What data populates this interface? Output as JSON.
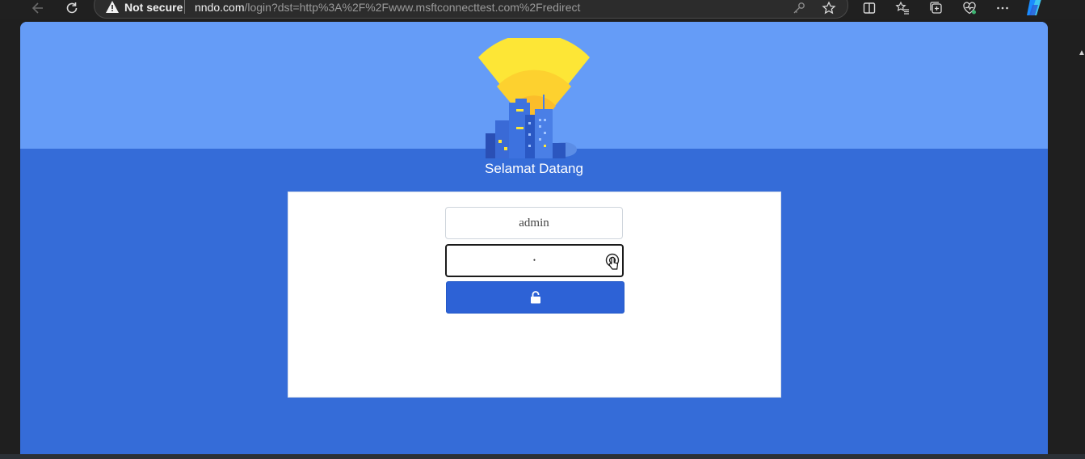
{
  "browser": {
    "security_label": "Not secure",
    "url_host": "nndo.com",
    "url_path": "/login?dst=http%3A%2F%2Fwww.msftconnecttest.com%2Fredirect",
    "icons": [
      "back-icon",
      "reload-icon",
      "warning-icon",
      "key-icon",
      "favorite-star-icon",
      "split-screen-icon",
      "favorites-icon",
      "collections-icon",
      "browser-essentials-icon",
      "more-icon",
      "copilot-icon"
    ]
  },
  "page": {
    "welcome_text": "Selamat Datang",
    "colors": {
      "top": "#659cf7",
      "bottom": "#356cd8",
      "button": "#2d62d6"
    }
  },
  "login": {
    "username_value": "admin",
    "password_value": "•",
    "submit_icon": "lock-icon"
  }
}
